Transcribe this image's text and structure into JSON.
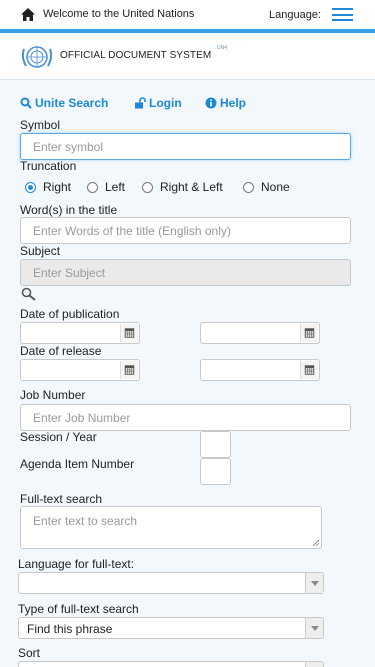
{
  "topbar": {
    "welcome": "Welcome to the United Nations",
    "language_label": "Language:"
  },
  "brand": {
    "title": "OFFICIAL DOCUMENT SYSTEM",
    "beta": "UN4"
  },
  "nav": {
    "unite_search": "Unite Search",
    "login": "Login",
    "help": "Help"
  },
  "form": {
    "symbol": {
      "label": "Symbol",
      "placeholder": "Enter symbol"
    },
    "truncation": {
      "label": "Truncation",
      "options": [
        "Right",
        "Left",
        "Right & Left",
        "None"
      ],
      "selected": "Right"
    },
    "title_words": {
      "label": "Word(s) in the title",
      "placeholder": "Enter Words of the title (English only)"
    },
    "subject": {
      "label": "Subject",
      "placeholder": "Enter Subject"
    },
    "date_publication": {
      "label": "Date of publication"
    },
    "date_release": {
      "label": "Date of release"
    },
    "job_number": {
      "label": "Job Number",
      "placeholder": "Enter Job Number"
    },
    "session_year": {
      "label": "Session / Year"
    },
    "agenda_item": {
      "label": "Agenda Item Number"
    },
    "fulltext": {
      "label": "Full-text search",
      "placeholder": "Enter text to search"
    },
    "fulltext_language": {
      "label": "Language for full-text:",
      "value": ""
    },
    "fulltext_type": {
      "label": "Type of full-text search",
      "value": "Find this phrase"
    },
    "sort": {
      "label": "Sort"
    }
  }
}
